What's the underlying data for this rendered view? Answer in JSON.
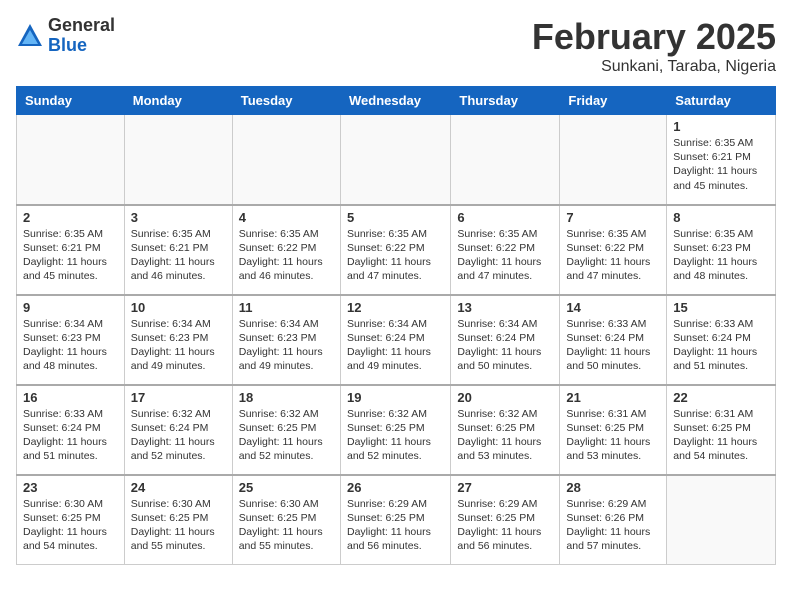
{
  "logo": {
    "general": "General",
    "blue": "Blue"
  },
  "title": "February 2025",
  "location": "Sunkani, Taraba, Nigeria",
  "days_of_week": [
    "Sunday",
    "Monday",
    "Tuesday",
    "Wednesday",
    "Thursday",
    "Friday",
    "Saturday"
  ],
  "weeks": [
    [
      {
        "day": "",
        "info": ""
      },
      {
        "day": "",
        "info": ""
      },
      {
        "day": "",
        "info": ""
      },
      {
        "day": "",
        "info": ""
      },
      {
        "day": "",
        "info": ""
      },
      {
        "day": "",
        "info": ""
      },
      {
        "day": "1",
        "info": "Sunrise: 6:35 AM\nSunset: 6:21 PM\nDaylight: 11 hours\nand 45 minutes."
      }
    ],
    [
      {
        "day": "2",
        "info": "Sunrise: 6:35 AM\nSunset: 6:21 PM\nDaylight: 11 hours\nand 45 minutes."
      },
      {
        "day": "3",
        "info": "Sunrise: 6:35 AM\nSunset: 6:21 PM\nDaylight: 11 hours\nand 46 minutes."
      },
      {
        "day": "4",
        "info": "Sunrise: 6:35 AM\nSunset: 6:22 PM\nDaylight: 11 hours\nand 46 minutes."
      },
      {
        "day": "5",
        "info": "Sunrise: 6:35 AM\nSunset: 6:22 PM\nDaylight: 11 hours\nand 47 minutes."
      },
      {
        "day": "6",
        "info": "Sunrise: 6:35 AM\nSunset: 6:22 PM\nDaylight: 11 hours\nand 47 minutes."
      },
      {
        "day": "7",
        "info": "Sunrise: 6:35 AM\nSunset: 6:22 PM\nDaylight: 11 hours\nand 47 minutes."
      },
      {
        "day": "8",
        "info": "Sunrise: 6:35 AM\nSunset: 6:23 PM\nDaylight: 11 hours\nand 48 minutes."
      }
    ],
    [
      {
        "day": "9",
        "info": "Sunrise: 6:34 AM\nSunset: 6:23 PM\nDaylight: 11 hours\nand 48 minutes."
      },
      {
        "day": "10",
        "info": "Sunrise: 6:34 AM\nSunset: 6:23 PM\nDaylight: 11 hours\nand 49 minutes."
      },
      {
        "day": "11",
        "info": "Sunrise: 6:34 AM\nSunset: 6:23 PM\nDaylight: 11 hours\nand 49 minutes."
      },
      {
        "day": "12",
        "info": "Sunrise: 6:34 AM\nSunset: 6:24 PM\nDaylight: 11 hours\nand 49 minutes."
      },
      {
        "day": "13",
        "info": "Sunrise: 6:34 AM\nSunset: 6:24 PM\nDaylight: 11 hours\nand 50 minutes."
      },
      {
        "day": "14",
        "info": "Sunrise: 6:33 AM\nSunset: 6:24 PM\nDaylight: 11 hours\nand 50 minutes."
      },
      {
        "day": "15",
        "info": "Sunrise: 6:33 AM\nSunset: 6:24 PM\nDaylight: 11 hours\nand 51 minutes."
      }
    ],
    [
      {
        "day": "16",
        "info": "Sunrise: 6:33 AM\nSunset: 6:24 PM\nDaylight: 11 hours\nand 51 minutes."
      },
      {
        "day": "17",
        "info": "Sunrise: 6:32 AM\nSunset: 6:24 PM\nDaylight: 11 hours\nand 52 minutes."
      },
      {
        "day": "18",
        "info": "Sunrise: 6:32 AM\nSunset: 6:25 PM\nDaylight: 11 hours\nand 52 minutes."
      },
      {
        "day": "19",
        "info": "Sunrise: 6:32 AM\nSunset: 6:25 PM\nDaylight: 11 hours\nand 52 minutes."
      },
      {
        "day": "20",
        "info": "Sunrise: 6:32 AM\nSunset: 6:25 PM\nDaylight: 11 hours\nand 53 minutes."
      },
      {
        "day": "21",
        "info": "Sunrise: 6:31 AM\nSunset: 6:25 PM\nDaylight: 11 hours\nand 53 minutes."
      },
      {
        "day": "22",
        "info": "Sunrise: 6:31 AM\nSunset: 6:25 PM\nDaylight: 11 hours\nand 54 minutes."
      }
    ],
    [
      {
        "day": "23",
        "info": "Sunrise: 6:30 AM\nSunset: 6:25 PM\nDaylight: 11 hours\nand 54 minutes."
      },
      {
        "day": "24",
        "info": "Sunrise: 6:30 AM\nSunset: 6:25 PM\nDaylight: 11 hours\nand 55 minutes."
      },
      {
        "day": "25",
        "info": "Sunrise: 6:30 AM\nSunset: 6:25 PM\nDaylight: 11 hours\nand 55 minutes."
      },
      {
        "day": "26",
        "info": "Sunrise: 6:29 AM\nSunset: 6:25 PM\nDaylight: 11 hours\nand 56 minutes."
      },
      {
        "day": "27",
        "info": "Sunrise: 6:29 AM\nSunset: 6:25 PM\nDaylight: 11 hours\nand 56 minutes."
      },
      {
        "day": "28",
        "info": "Sunrise: 6:29 AM\nSunset: 6:26 PM\nDaylight: 11 hours\nand 57 minutes."
      },
      {
        "day": "",
        "info": ""
      }
    ]
  ]
}
